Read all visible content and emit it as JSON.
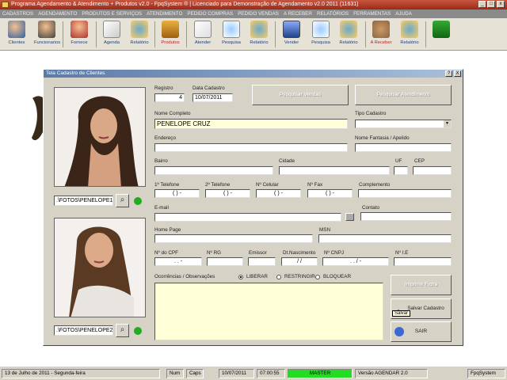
{
  "app": {
    "title": "Programa Agendamento & Atendimento + Produtos v2.0 - FpqSystem ® | Licenciado para Demonstração de Agendamento v2.0 2011 (11631)"
  },
  "menu": [
    "CADASTROS",
    "AGENDAMENTO",
    "PRODUTOS E SERVIÇOS",
    "ATENDIMENTO",
    "PEDIDO COMPRAS",
    "PEDIDO VENDAS",
    "A RECEBER",
    "RELATÓRIOS",
    "FERRAMENTAS",
    "AJUDA"
  ],
  "toolbar": [
    "Clientes",
    "Funcionarios",
    "Fornece",
    "Agenda",
    "Relatório",
    "Produtos",
    "Atender",
    "Pesquisa",
    "Relatório",
    "Vender",
    "Pesquisa",
    "Relatório",
    "A Receber",
    "Relatório",
    ""
  ],
  "window": {
    "title": "Tela Cadastro de Clientes",
    "help_label": "?",
    "close_label": "X"
  },
  "photos": {
    "path1": ".\\FOTOS\\PENELOPE1",
    "path2": ".\\FOTOS\\PENELOPE2.J"
  },
  "form": {
    "registro_label": "Registro",
    "registro_value": "4",
    "data_label": "Data Cadastro",
    "data_value": "10/07/2011",
    "pesquisar_vendas": "Pesquisar Vendas",
    "pesquisar_atendimento": "Pesquisar Atendimento",
    "nome_label": "Nome Completo",
    "nome_value": "PENELOPE CRUZ",
    "tipo_label": "Tipo Cadastro",
    "endereco_label": "Endereço",
    "fantasia_label": "Nome Fantasia / Apelido",
    "bairro_label": "Bairro",
    "cidade_label": "Cidade",
    "uf_label": "UF",
    "cep_label": "CEP",
    "tel1_label": "1º Telefone",
    "tel1_value": "(  )   -",
    "tel2_label": "2º Telefone",
    "tel2_value": "(  )   -",
    "cel_label": "Nº Celular",
    "cel_value": "(  )   -",
    "fax_label": "Nº Fax",
    "fax_value": "(  )   -",
    "comp_label": "Complemento",
    "email_label": "E-mail",
    "contato_label": "Contato",
    "home_label": "Home Page",
    "msn_label": "MSN",
    "cpf_label": "Nº do CPF",
    "cpf_value": ".   .   -",
    "rg_label": "Nº RG",
    "emissor_label": "Emissor",
    "nasc_label": "Dt.Nascimento",
    "nasc_value": "/  /",
    "cnpj_label": "Nº CNPJ",
    "cnpj_value": ".   .   /   -",
    "ie_label": "Nº I.E",
    "obs_label": "Ocorrências / Observações",
    "radio_liberar": "LIBERAR",
    "radio_restringir": "RESTRINGIR",
    "radio_bloquear": "BLOQUEAR",
    "imprimir_label": "Imprimir Ficha",
    "salvar_label": "Salvar Cadastro",
    "salvar_tooltip": "Salvar",
    "sair_label": "SAIR"
  },
  "status": {
    "date": "13 de Julho de 2011 - Segunda-feira",
    "num": "Num",
    "caps": "Caps",
    "d2": "10/07/2011",
    "time": "07:00:55",
    "user": "MASTER",
    "version": "Versão AGENDAR 2.0",
    "company": "FpqSystem"
  },
  "colors": {
    "title": "#b03a24",
    "menu": "#8a8a8a",
    "window": "#d6d2c6",
    "highlight": "#ffffd8",
    "master": "#22dd22"
  }
}
